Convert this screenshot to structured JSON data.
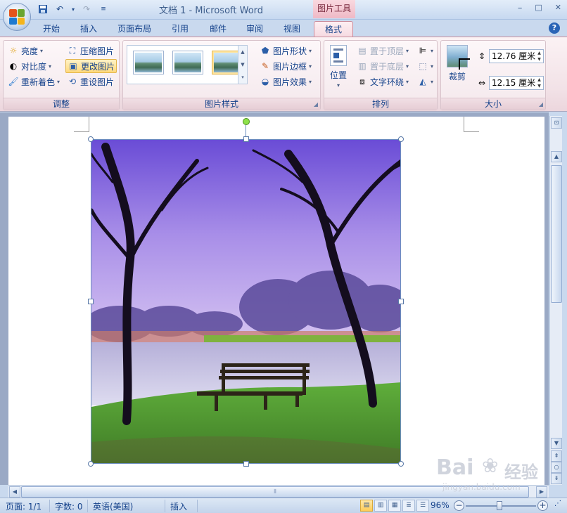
{
  "window": {
    "title": "文档 1 - Microsoft Word",
    "context_tab_group": "图片工具",
    "minimize": "–",
    "maximize": "□",
    "close": "✕"
  },
  "tabs": [
    "开始",
    "插入",
    "页面布局",
    "引用",
    "邮件",
    "审阅",
    "视图",
    "格式"
  ],
  "active_tab": "格式",
  "help_label": "?",
  "groups": {
    "adjust": {
      "label": "调整",
      "brightness": "亮度",
      "contrast": "对比度",
      "recolor": "重新着色",
      "compress": "压缩图片",
      "change_picture": "更改图片",
      "reset_picture": "重设图片"
    },
    "picture_styles": {
      "label": "图片样式",
      "shape": "图片形状",
      "border": "图片边框",
      "effects": "图片效果"
    },
    "arrange": {
      "label": "排列",
      "position": "位置",
      "bring_front": "置于顶层",
      "send_back": "置于底层",
      "text_wrap": "文字环绕"
    },
    "size": {
      "label": "大小",
      "crop": "裁剪",
      "height_value": "12.76 厘米",
      "width_value": "12.15 厘米"
    }
  },
  "status": {
    "page": "页面: 1/1",
    "words": "字数: 0",
    "language": "英语(美国)",
    "mode": "插入",
    "zoom": "96%",
    "zoom_fraction": 0.48
  },
  "watermark": {
    "brand": "Bai",
    "brand_suffix": "经验",
    "url": "jingyan.baidu.com"
  },
  "colors": {
    "accent": "#15428b",
    "context_tab": "#efb9c6",
    "highlight": "#ffd97c"
  }
}
